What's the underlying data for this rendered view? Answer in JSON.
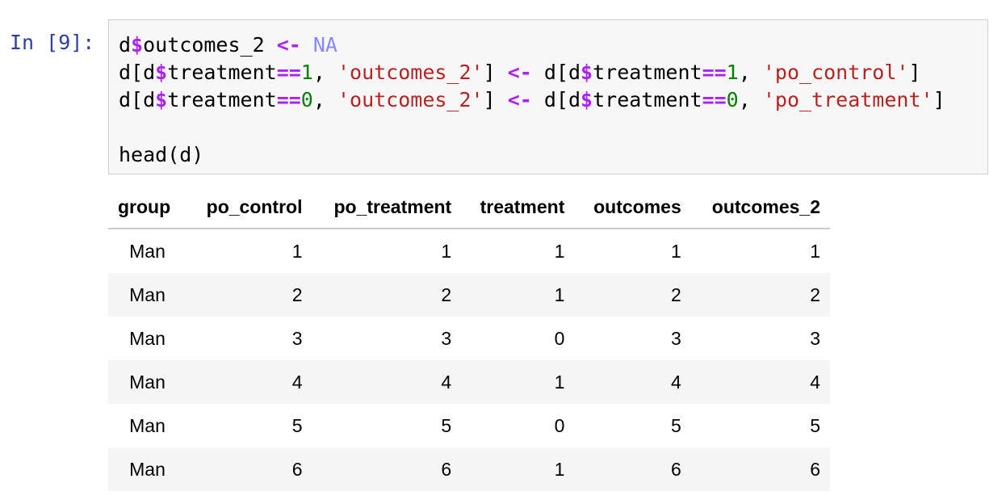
{
  "cell": {
    "prompt": "In [9]:",
    "code_lines": [
      [
        {
          "t": "d",
          "c": "plain"
        },
        {
          "t": "$",
          "c": "op"
        },
        {
          "t": "outcomes_2 ",
          "c": "plain"
        },
        {
          "t": "<-",
          "c": "op"
        },
        {
          "t": " ",
          "c": "plain"
        },
        {
          "t": "NA",
          "c": "na"
        }
      ],
      [
        {
          "t": "d[d",
          "c": "plain"
        },
        {
          "t": "$",
          "c": "op"
        },
        {
          "t": "treatment",
          "c": "plain"
        },
        {
          "t": "==",
          "c": "op"
        },
        {
          "t": "1",
          "c": "num"
        },
        {
          "t": ", ",
          "c": "plain"
        },
        {
          "t": "'outcomes_2'",
          "c": "str"
        },
        {
          "t": "] ",
          "c": "plain"
        },
        {
          "t": "<-",
          "c": "op"
        },
        {
          "t": " d[d",
          "c": "plain"
        },
        {
          "t": "$",
          "c": "op"
        },
        {
          "t": "treatment",
          "c": "plain"
        },
        {
          "t": "==",
          "c": "op"
        },
        {
          "t": "1",
          "c": "num"
        },
        {
          "t": ", ",
          "c": "plain"
        },
        {
          "t": "'po_control'",
          "c": "str"
        },
        {
          "t": "]",
          "c": "plain"
        }
      ],
      [
        {
          "t": "d[d",
          "c": "plain"
        },
        {
          "t": "$",
          "c": "op"
        },
        {
          "t": "treatment",
          "c": "plain"
        },
        {
          "t": "==",
          "c": "op"
        },
        {
          "t": "0",
          "c": "num"
        },
        {
          "t": ", ",
          "c": "plain"
        },
        {
          "t": "'outcomes_2'",
          "c": "str"
        },
        {
          "t": "] ",
          "c": "plain"
        },
        {
          "t": "<-",
          "c": "op"
        },
        {
          "t": " d[d",
          "c": "plain"
        },
        {
          "t": "$",
          "c": "op"
        },
        {
          "t": "treatment",
          "c": "plain"
        },
        {
          "t": "==",
          "c": "op"
        },
        {
          "t": "0",
          "c": "num"
        },
        {
          "t": ", ",
          "c": "plain"
        },
        {
          "t": "'po_treatment'",
          "c": "str"
        },
        {
          "t": "]",
          "c": "plain"
        }
      ],
      [],
      [
        {
          "t": "head(d)",
          "c": "plain"
        }
      ]
    ]
  },
  "output": {
    "columns": [
      "group",
      "po_control",
      "po_treatment",
      "treatment",
      "outcomes",
      "outcomes_2"
    ],
    "rows": [
      [
        "Man",
        "1",
        "1",
        "1",
        "1",
        "1"
      ],
      [
        "Man",
        "2",
        "2",
        "1",
        "2",
        "2"
      ],
      [
        "Man",
        "3",
        "3",
        "0",
        "3",
        "3"
      ],
      [
        "Man",
        "4",
        "4",
        "1",
        "4",
        "4"
      ],
      [
        "Man",
        "5",
        "5",
        "0",
        "5",
        "5"
      ],
      [
        "Man",
        "6",
        "6",
        "1",
        "6",
        "6"
      ]
    ]
  },
  "colors": {
    "prompt": "#303f9f",
    "operator": "#aa22ff",
    "na_constant": "#8888ff",
    "string": "#ba2121",
    "number": "#008000",
    "input_background": "#f7f7f7",
    "row_stripe": "#f5f5f5"
  }
}
